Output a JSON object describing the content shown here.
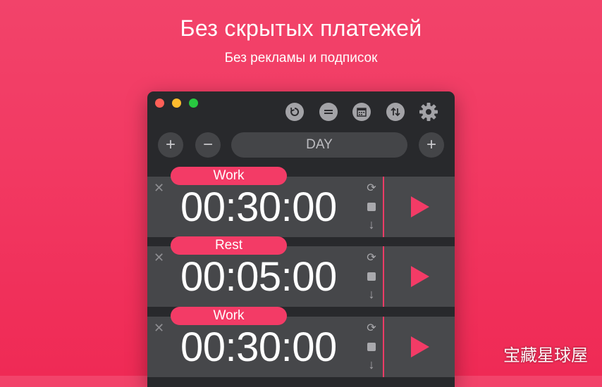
{
  "promo": {
    "headline": "Без скрытых платежей",
    "subheadline": "Без рекламы и подписок"
  },
  "window": {
    "toolbar": {
      "icons": [
        "reset-icon",
        "equal-icon",
        "calendar-icon",
        "sort-icon",
        "gear-icon"
      ]
    },
    "controls": {
      "add_left_label": "+",
      "remove_label": "−",
      "mode_label": "DAY",
      "add_right_label": "+"
    },
    "timers": [
      {
        "label": "Work",
        "time": "00:30:00",
        "close": "✕",
        "loop_icon": "⟳",
        "down_icon": "↓"
      },
      {
        "label": "Rest",
        "time": "00:05:00",
        "close": "✕",
        "loop_icon": "⟳",
        "down_icon": "↓"
      },
      {
        "label": "Work",
        "time": "00:30:00",
        "close": "✕",
        "loop_icon": "⟳",
        "down_icon": "↓"
      }
    ]
  },
  "watermark": "宝藏星球屋",
  "colors": {
    "accent": "#f33b66",
    "window_bg": "#28292c",
    "row_bg": "#46474a"
  }
}
